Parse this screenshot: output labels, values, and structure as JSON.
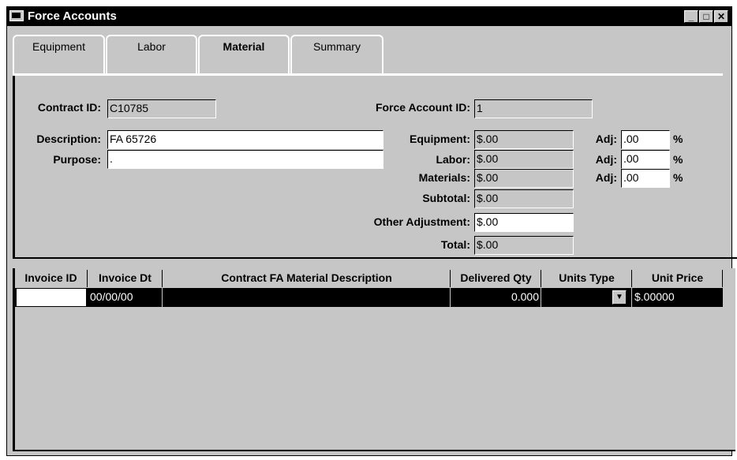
{
  "window": {
    "title": "Force Accounts",
    "controls": {
      "minimize": "_",
      "maximize": "□",
      "close": "✕"
    }
  },
  "tabs": [
    "Equipment",
    "Labor",
    "Material",
    "Summary"
  ],
  "active_tab": "Material",
  "form": {
    "contract_id": {
      "label": "Contract ID:",
      "value": "C10785"
    },
    "force_account_id": {
      "label": "Force Account ID:",
      "value": "1"
    },
    "description": {
      "label": "Description:",
      "value": "FA 65726"
    },
    "purpose": {
      "label": "Purpose:",
      "value": "."
    },
    "equipment": {
      "label": "Equipment:",
      "value": "$.00",
      "adj_label": "Adj:",
      "adj_value": ".00",
      "pct": "%"
    },
    "labor": {
      "label": "Labor:",
      "value": "$.00",
      "adj_label": "Adj:",
      "adj_value": ".00",
      "pct": "%"
    },
    "materials": {
      "label": "Materials:",
      "value": "$.00",
      "adj_label": "Adj:",
      "adj_value": ".00",
      "pct": "%"
    },
    "subtotal": {
      "label": "Subtotal:",
      "value": "$.00"
    },
    "other_adjustment": {
      "label": "Other Adjustment:",
      "value": "$.00"
    },
    "total": {
      "label": "Total:",
      "value": "$.00"
    }
  },
  "grid": {
    "columns": [
      "Invoice ID",
      "Invoice Dt",
      "Contract FA Material Description",
      "Delivered Qty",
      "Units Type",
      "Unit Price"
    ],
    "rows": [
      {
        "invoice_id": "",
        "invoice_dt": "00/00/00",
        "description": "",
        "delivered_qty": "0.000",
        "units_type": "",
        "unit_price": "$.00000"
      }
    ]
  }
}
